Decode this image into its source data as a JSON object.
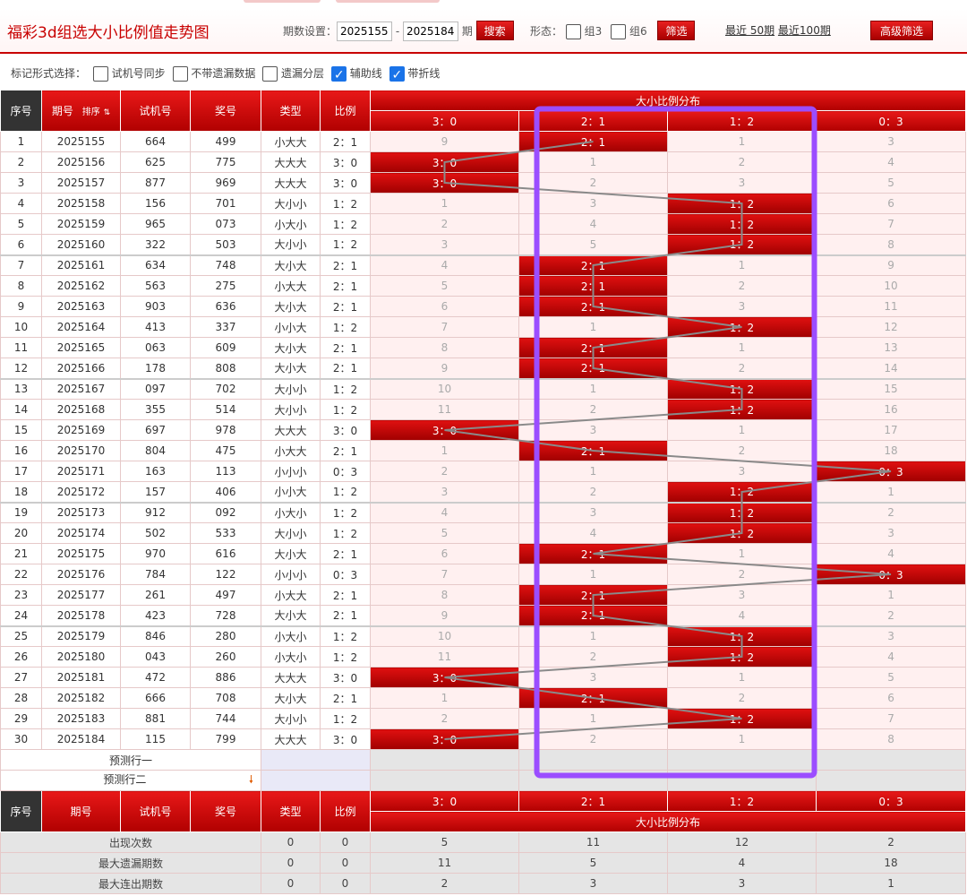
{
  "header": {
    "title": "福彩3d组选大小比例值走势图",
    "period_label": "期数设置：",
    "period_from": "2025155",
    "period_to": "2025184",
    "period_unit": "期",
    "search_button": "搜索",
    "form_label": "形态：",
    "group3_label": "组3",
    "group6_label": "组6",
    "filter_button": "筛选",
    "recent_50": "最近 50期",
    "recent_100": "最近100期",
    "advanced_button": "高级筛选"
  },
  "marks": {
    "label": "标记形式选择：",
    "opt_sync": "试机号同步",
    "opt_nomiss": "不带遗漏数据",
    "opt_layer": "遗漏分层",
    "opt_aux": "辅助线",
    "opt_line": "带折线",
    "checked": [
      false,
      false,
      false,
      true,
      true
    ]
  },
  "table": {
    "headers": {
      "seq": "序号",
      "issue": "期号",
      "sort": "排序",
      "trial": "试机号",
      "draw": "奖号",
      "type": "类型",
      "ratio": "比例",
      "dist": "大小比例分布",
      "cols": [
        "3：0",
        "2：1",
        "1：2",
        "0：3"
      ]
    },
    "rows": [
      {
        "seq": "1",
        "issue": "2025155",
        "trial": "664",
        "draw": "499",
        "type": "小大大",
        "ratio": "2：1",
        "c": [
          "9",
          "2：1",
          "1",
          "3"
        ],
        "hit": 1
      },
      {
        "seq": "2",
        "issue": "2025156",
        "trial": "625",
        "draw": "775",
        "type": "大大大",
        "ratio": "3：0",
        "c": [
          "3：0",
          "1",
          "2",
          "4"
        ],
        "hit": 0
      },
      {
        "seq": "3",
        "issue": "2025157",
        "trial": "877",
        "draw": "969",
        "type": "大大大",
        "ratio": "3：0",
        "c": [
          "3：0",
          "2",
          "3",
          "5"
        ],
        "hit": 0
      },
      {
        "seq": "4",
        "issue": "2025158",
        "trial": "156",
        "draw": "701",
        "type": "大小小",
        "ratio": "1：2",
        "c": [
          "1",
          "3",
          "1：2",
          "6"
        ],
        "hit": 2
      },
      {
        "seq": "5",
        "issue": "2025159",
        "trial": "965",
        "draw": "073",
        "type": "小大小",
        "ratio": "1：2",
        "c": [
          "2",
          "4",
          "1：2",
          "7"
        ],
        "hit": 2
      },
      {
        "seq": "6",
        "issue": "2025160",
        "trial": "322",
        "draw": "503",
        "type": "大小小",
        "ratio": "1：2",
        "c": [
          "3",
          "5",
          "1：2",
          "8"
        ],
        "hit": 2
      },
      {
        "seq": "7",
        "issue": "2025161",
        "trial": "634",
        "draw": "748",
        "type": "大小大",
        "ratio": "2：1",
        "c": [
          "4",
          "2：1",
          "1",
          "9"
        ],
        "hit": 1
      },
      {
        "seq": "8",
        "issue": "2025162",
        "trial": "563",
        "draw": "275",
        "type": "小大大",
        "ratio": "2：1",
        "c": [
          "5",
          "2：1",
          "2",
          "10"
        ],
        "hit": 1
      },
      {
        "seq": "9",
        "issue": "2025163",
        "trial": "903",
        "draw": "636",
        "type": "大小大",
        "ratio": "2：1",
        "c": [
          "6",
          "2：1",
          "3",
          "11"
        ],
        "hit": 1
      },
      {
        "seq": "10",
        "issue": "2025164",
        "trial": "413",
        "draw": "337",
        "type": "小小大",
        "ratio": "1：2",
        "c": [
          "7",
          "1",
          "1：2",
          "12"
        ],
        "hit": 2
      },
      {
        "seq": "11",
        "issue": "2025165",
        "trial": "063",
        "draw": "609",
        "type": "大小大",
        "ratio": "2：1",
        "c": [
          "8",
          "2：1",
          "1",
          "13"
        ],
        "hit": 1
      },
      {
        "seq": "12",
        "issue": "2025166",
        "trial": "178",
        "draw": "808",
        "type": "大小大",
        "ratio": "2：1",
        "c": [
          "9",
          "2：1",
          "2",
          "14"
        ],
        "hit": 1
      },
      {
        "seq": "13",
        "issue": "2025167",
        "trial": "097",
        "draw": "702",
        "type": "大小小",
        "ratio": "1：2",
        "c": [
          "10",
          "1",
          "1：2",
          "15"
        ],
        "hit": 2
      },
      {
        "seq": "14",
        "issue": "2025168",
        "trial": "355",
        "draw": "514",
        "type": "大小小",
        "ratio": "1：2",
        "c": [
          "11",
          "2",
          "1：2",
          "16"
        ],
        "hit": 2
      },
      {
        "seq": "15",
        "issue": "2025169",
        "trial": "697",
        "draw": "978",
        "type": "大大大",
        "ratio": "3：0",
        "c": [
          "3：0",
          "3",
          "1",
          "17"
        ],
        "hit": 0
      },
      {
        "seq": "16",
        "issue": "2025170",
        "trial": "804",
        "draw": "475",
        "type": "小大大",
        "ratio": "2：1",
        "c": [
          "1",
          "2：1",
          "2",
          "18"
        ],
        "hit": 1
      },
      {
        "seq": "17",
        "issue": "2025171",
        "trial": "163",
        "draw": "113",
        "type": "小小小",
        "ratio": "0：3",
        "c": [
          "2",
          "1",
          "3",
          "0：3"
        ],
        "hit": 3
      },
      {
        "seq": "18",
        "issue": "2025172",
        "trial": "157",
        "draw": "406",
        "type": "小小大",
        "ratio": "1：2",
        "c": [
          "3",
          "2",
          "1：2",
          "1"
        ],
        "hit": 2
      },
      {
        "seq": "19",
        "issue": "2025173",
        "trial": "912",
        "draw": "092",
        "type": "小大小",
        "ratio": "1：2",
        "c": [
          "4",
          "3",
          "1：2",
          "2"
        ],
        "hit": 2
      },
      {
        "seq": "20",
        "issue": "2025174",
        "trial": "502",
        "draw": "533",
        "type": "大小小",
        "ratio": "1：2",
        "c": [
          "5",
          "4",
          "1：2",
          "3"
        ],
        "hit": 2
      },
      {
        "seq": "21",
        "issue": "2025175",
        "trial": "970",
        "draw": "616",
        "type": "大小大",
        "ratio": "2：1",
        "c": [
          "6",
          "2：1",
          "1",
          "4"
        ],
        "hit": 1
      },
      {
        "seq": "22",
        "issue": "2025176",
        "trial": "784",
        "draw": "122",
        "type": "小小小",
        "ratio": "0：3",
        "c": [
          "7",
          "1",
          "2",
          "0：3"
        ],
        "hit": 3
      },
      {
        "seq": "23",
        "issue": "2025177",
        "trial": "261",
        "draw": "497",
        "type": "小大大",
        "ratio": "2：1",
        "c": [
          "8",
          "2：1",
          "3",
          "1"
        ],
        "hit": 1
      },
      {
        "seq": "24",
        "issue": "2025178",
        "trial": "423",
        "draw": "728",
        "type": "大小大",
        "ratio": "2：1",
        "c": [
          "9",
          "2：1",
          "4",
          "2"
        ],
        "hit": 1
      },
      {
        "seq": "25",
        "issue": "2025179",
        "trial": "846",
        "draw": "280",
        "type": "小大小",
        "ratio": "1：2",
        "c": [
          "10",
          "1",
          "1：2",
          "3"
        ],
        "hit": 2
      },
      {
        "seq": "26",
        "issue": "2025180",
        "trial": "043",
        "draw": "260",
        "type": "小大小",
        "ratio": "1：2",
        "c": [
          "11",
          "2",
          "1：2",
          "4"
        ],
        "hit": 2
      },
      {
        "seq": "27",
        "issue": "2025181",
        "trial": "472",
        "draw": "886",
        "type": "大大大",
        "ratio": "3：0",
        "c": [
          "3：0",
          "3",
          "1",
          "5"
        ],
        "hit": 0
      },
      {
        "seq": "28",
        "issue": "2025182",
        "trial": "666",
        "draw": "708",
        "type": "大小大",
        "ratio": "2：1",
        "c": [
          "1",
          "2：1",
          "2",
          "6"
        ],
        "hit": 1
      },
      {
        "seq": "29",
        "issue": "2025183",
        "trial": "881",
        "draw": "744",
        "type": "大小小",
        "ratio": "1：2",
        "c": [
          "2",
          "1",
          "1：2",
          "7"
        ],
        "hit": 2
      },
      {
        "seq": "30",
        "issue": "2025184",
        "trial": "115",
        "draw": "799",
        "type": "大大大",
        "ratio": "3：0",
        "c": [
          "3：0",
          "2",
          "1",
          "8"
        ],
        "hit": 0
      }
    ],
    "predict1": "预测行一",
    "predict2": "预测行二",
    "stats": [
      {
        "label": "出现次数",
        "type": "0",
        "ratio": "0",
        "c": [
          "5",
          "11",
          "12",
          "2"
        ]
      },
      {
        "label": "最大遗漏期数",
        "type": "0",
        "ratio": "0",
        "c": [
          "11",
          "5",
          "4",
          "18"
        ]
      },
      {
        "label": "最大连出期数",
        "type": "0",
        "ratio": "0",
        "c": [
          "2",
          "3",
          "3",
          "1"
        ]
      }
    ]
  },
  "colors": {
    "accent": "#c80000",
    "hit_cell": "#c00000",
    "miss_cell": "#fff0f0",
    "trend_line": "#8a8a8a",
    "highlight_box": "#9b4dff"
  }
}
